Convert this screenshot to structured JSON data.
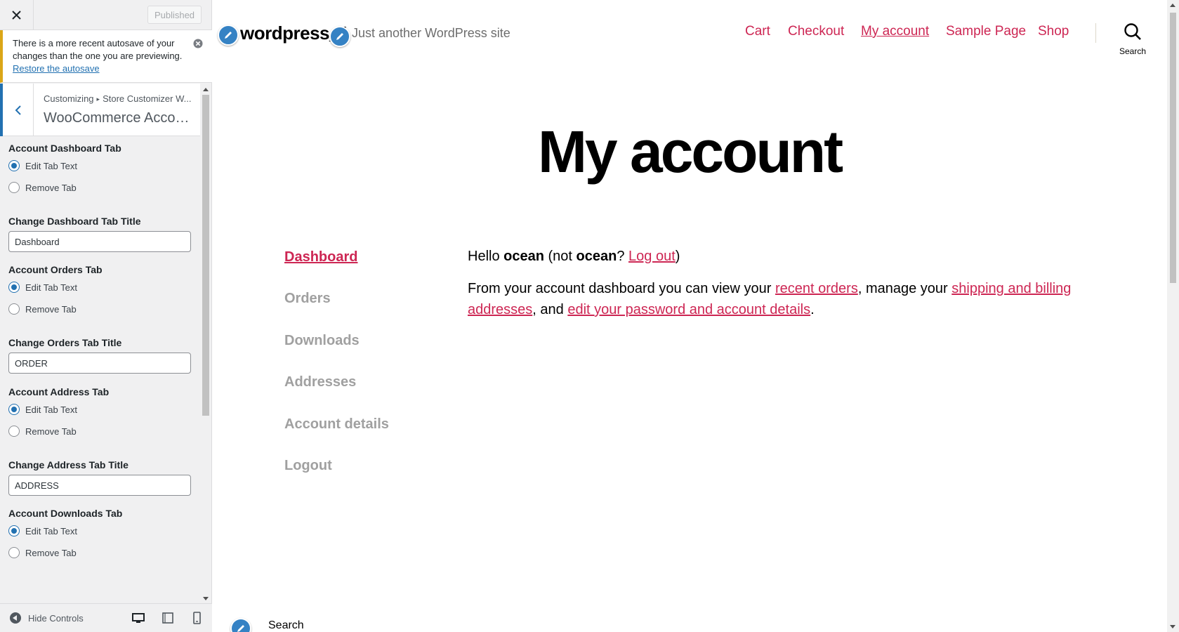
{
  "customizer": {
    "close_icon": "close-icon",
    "publish_label": "Published",
    "autosave": {
      "message": "There is a more recent autosave of your changes than the one you are previewing.",
      "restore_link": "Restore the autosave",
      "dismiss_icon": "dismiss-circle-icon"
    },
    "panel": {
      "back_icon": "chevron-left-icon",
      "crumb_root": "Customizing",
      "crumb_section": "Store Customizer W...",
      "title": "WooCommerce Account..."
    },
    "sections": [
      {
        "label": "Account Dashboard Tab",
        "options": [
          "Edit Tab Text",
          "Remove Tab"
        ],
        "selected": 0,
        "field_label": "Change Dashboard Tab Title",
        "field_value": "Dashboard"
      },
      {
        "label": "Account Orders Tab",
        "options": [
          "Edit Tab Text",
          "Remove Tab"
        ],
        "selected": 0,
        "field_label": "Change Orders Tab Title",
        "field_value": "ORDER"
      },
      {
        "label": "Account Address Tab",
        "options": [
          "Edit Tab Text",
          "Remove Tab"
        ],
        "selected": 0,
        "field_label": "Change Address Tab Title",
        "field_value": "ADDRESS"
      },
      {
        "label": "Account Downloads Tab",
        "options": [
          "Edit Tab Text",
          "Remove Tab"
        ],
        "selected": 0
      }
    ],
    "footer": {
      "hide_controls_label": "Hide Controls",
      "devices": [
        "desktop-icon",
        "tablet-icon",
        "mobile-icon"
      ]
    }
  },
  "preview": {
    "site_title": "wordpress_1",
    "tagline": "Just another WordPress site",
    "nav": [
      {
        "label": "Cart",
        "current": false
      },
      {
        "label": "Checkout",
        "current": false
      },
      {
        "label": "My account",
        "current": true
      },
      {
        "label": "Sample Page",
        "current": false
      },
      {
        "label": "Shop",
        "current": false
      }
    ],
    "search_label": "Search",
    "page_title": "My account",
    "account_nav": [
      {
        "label": "Dashboard",
        "active": true
      },
      {
        "label": "Orders",
        "active": false
      },
      {
        "label": "Downloads",
        "active": false
      },
      {
        "label": "Addresses",
        "active": false
      },
      {
        "label": "Account details",
        "active": false
      },
      {
        "label": "Logout",
        "active": false
      }
    ],
    "greeting": {
      "hello": "Hello ",
      "user": "ocean",
      "not": " (not ",
      "user2": "ocean",
      "q": "? ",
      "logout": "Log out",
      "close": ")"
    },
    "intro": {
      "t1": "From your account dashboard you can view your ",
      "link1": "recent orders",
      "t2": ", manage your ",
      "link2": "shipping and billing addresses",
      "t3": ", and ",
      "link3": "edit your password and account details",
      "t4": "."
    },
    "footer_search": "Search",
    "colors": {
      "accent": "#cd2653",
      "customizer_blue": "#2271b1",
      "notice": "#dba617"
    }
  }
}
